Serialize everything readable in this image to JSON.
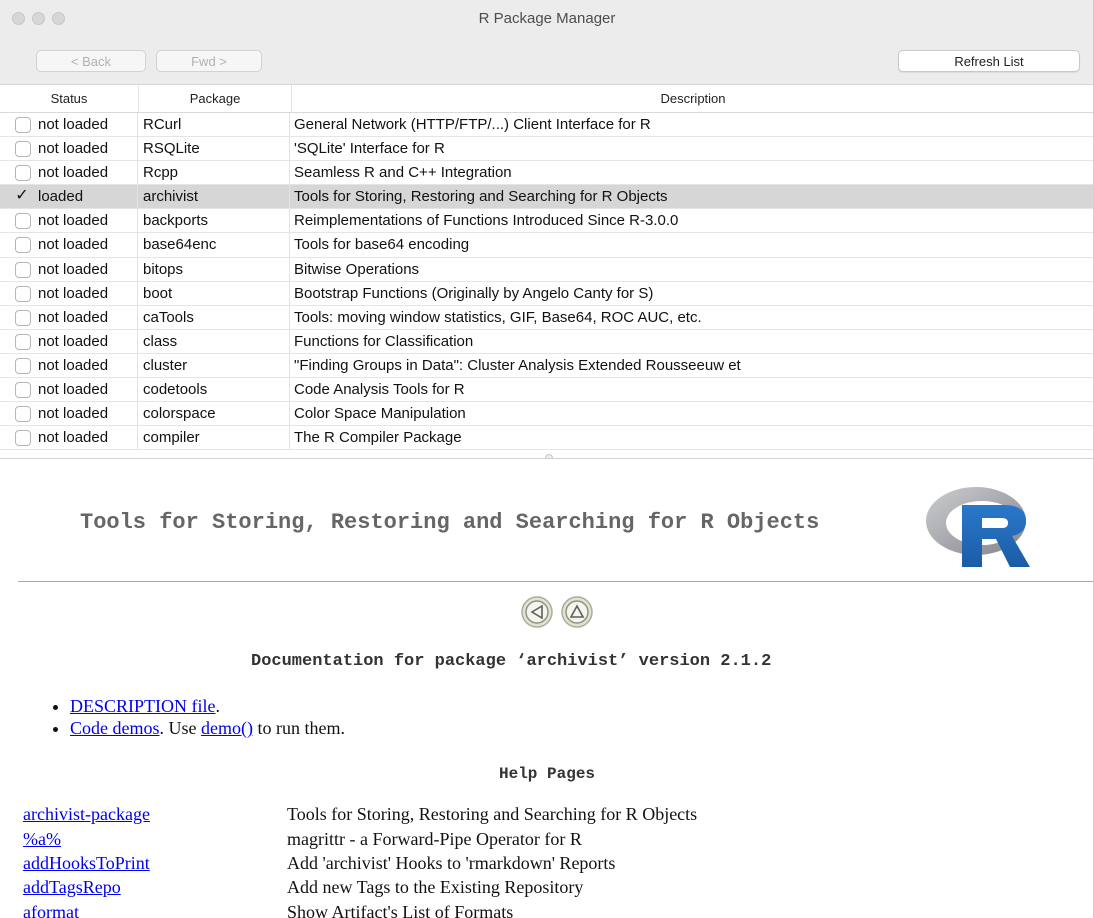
{
  "window": {
    "title": "R Package Manager"
  },
  "toolbar": {
    "back_label": "< Back",
    "fwd_label": "Fwd >",
    "refresh_label": "Refresh List"
  },
  "table": {
    "headers": {
      "status": "Status",
      "package": "Package",
      "description": "Description"
    },
    "rows": [
      {
        "checked": false,
        "status": "not loaded",
        "package": "RCurl",
        "description": "General Network (HTTP/FTP/...) Client Interface for R",
        "selected": false
      },
      {
        "checked": false,
        "status": "not loaded",
        "package": "RSQLite",
        "description": "'SQLite' Interface for R",
        "selected": false
      },
      {
        "checked": false,
        "status": "not loaded",
        "package": "Rcpp",
        "description": "Seamless R and C++ Integration",
        "selected": false
      },
      {
        "checked": true,
        "status": "loaded",
        "package": "archivist",
        "description": "Tools for Storing, Restoring and Searching for R Objects",
        "selected": true
      },
      {
        "checked": false,
        "status": "not loaded",
        "package": "backports",
        "description": "Reimplementations of Functions Introduced Since R-3.0.0",
        "selected": false
      },
      {
        "checked": false,
        "status": "not loaded",
        "package": "base64enc",
        "description": "Tools for base64 encoding",
        "selected": false
      },
      {
        "checked": false,
        "status": "not loaded",
        "package": "bitops",
        "description": "Bitwise Operations",
        "selected": false
      },
      {
        "checked": false,
        "status": "not loaded",
        "package": "boot",
        "description": "Bootstrap Functions (Originally by Angelo Canty for S)",
        "selected": false
      },
      {
        "checked": false,
        "status": "not loaded",
        "package": "caTools",
        "description": "Tools: moving window statistics, GIF, Base64, ROC AUC, etc.",
        "selected": false
      },
      {
        "checked": false,
        "status": "not loaded",
        "package": "class",
        "description": "Functions for Classification",
        "selected": false
      },
      {
        "checked": false,
        "status": "not loaded",
        "package": "cluster",
        "description": "\"Finding Groups in Data\": Cluster Analysis Extended Rousseeuw et",
        "selected": false
      },
      {
        "checked": false,
        "status": "not loaded",
        "package": "codetools",
        "description": "Code Analysis Tools for R",
        "selected": false
      },
      {
        "checked": false,
        "status": "not loaded",
        "package": "colorspace",
        "description": "Color Space Manipulation",
        "selected": false
      },
      {
        "checked": false,
        "status": "not loaded",
        "package": "compiler",
        "description": "The R Compiler Package",
        "selected": false
      }
    ],
    "checkmark": "✓"
  },
  "doc": {
    "title": "Tools for Storing, Restoring and Searching for R Objects",
    "doc_line": "Documentation for package ‘archivist’ version 2.1.2",
    "bullets": {
      "desc_link": "DESCRIPTION file",
      "desc_suffix": ".",
      "demos_link": "Code demos",
      "demos_mid": ". Use ",
      "demo_fn_link": "demo()",
      "demos_suffix": " to run them."
    },
    "help_pages_heading": "Help Pages",
    "help_rows": [
      {
        "name": "archivist-package",
        "description": "Tools for Storing, Restoring and Searching for R Objects"
      },
      {
        "name": "%a%",
        "description": "magrittr - a Forward-Pipe Operator for R"
      },
      {
        "name": "addHooksToPrint",
        "description": "Add 'archivist' Hooks to 'rmarkdown' Reports"
      },
      {
        "name": "addTagsRepo",
        "description": "Add new Tags to the Existing Repository"
      },
      {
        "name": "aformat",
        "description": "Show Artifact's List of Formats"
      }
    ],
    "logo_letter": "R"
  },
  "colors": {
    "selected_row": "#d6d6d6",
    "link": "#0000ee",
    "r_logo_blue": "#2165b6",
    "r_logo_gray": "#a2a3a8"
  }
}
